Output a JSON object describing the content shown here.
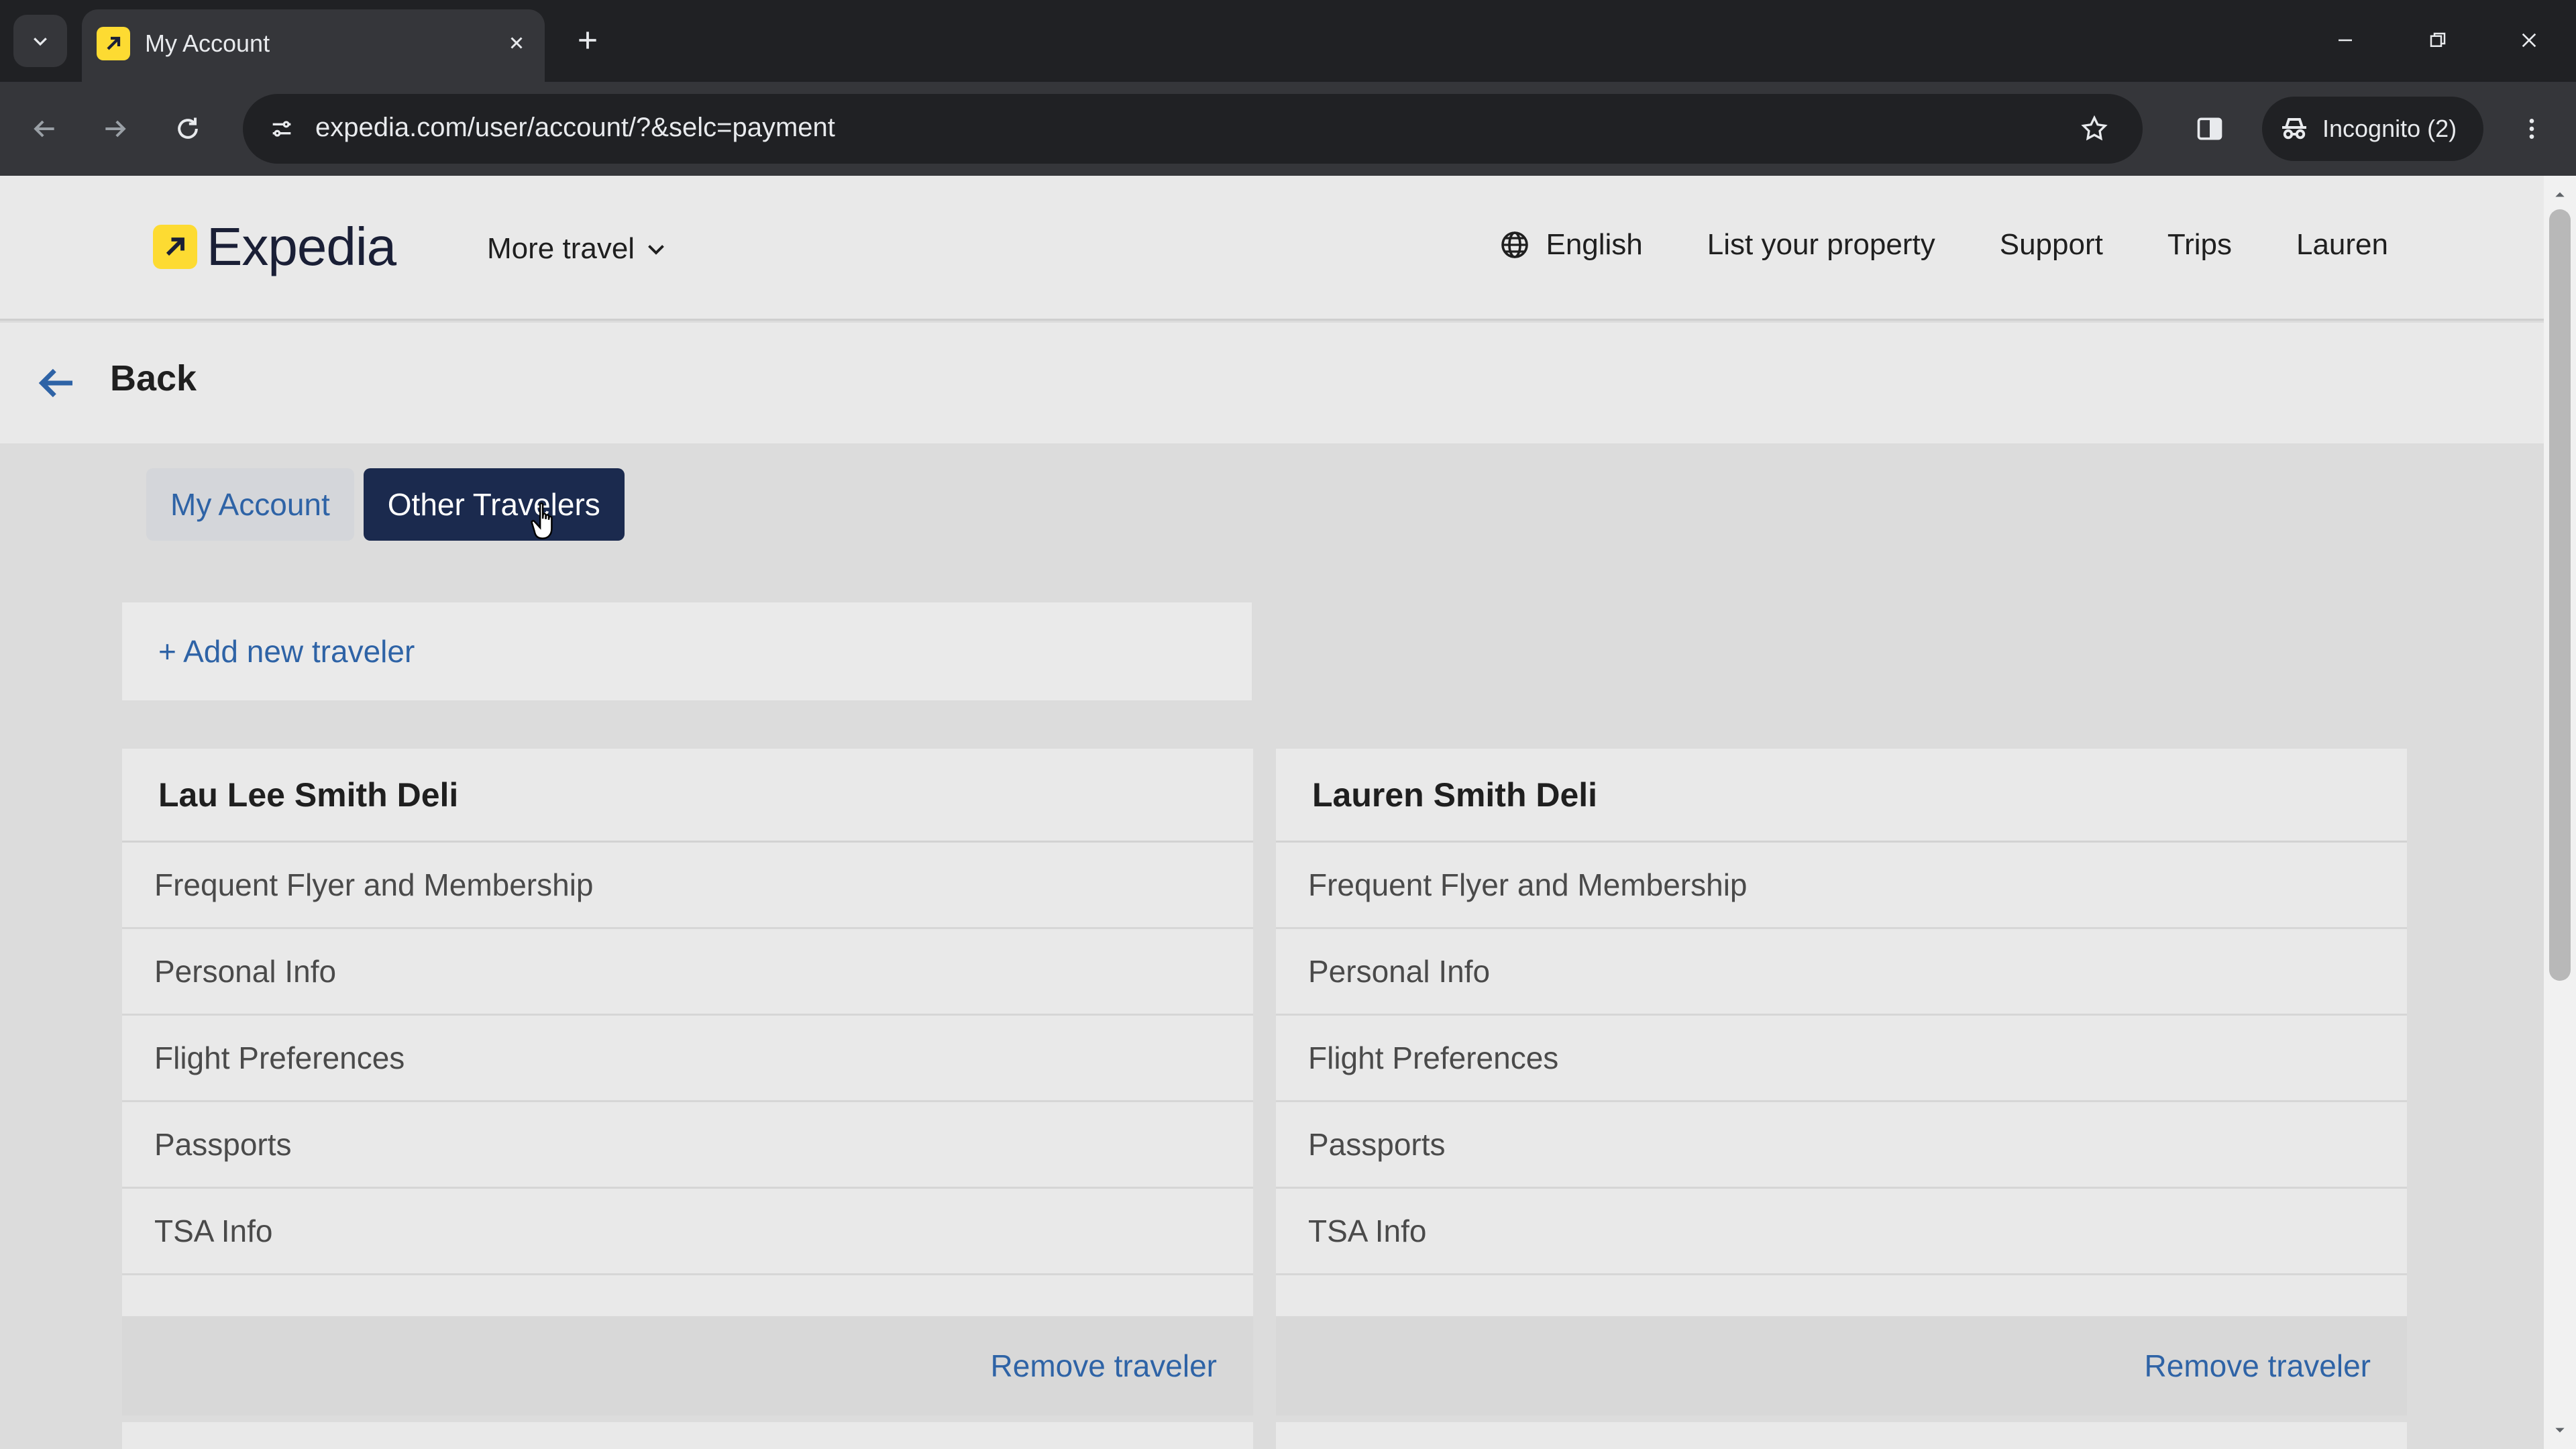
{
  "browser": {
    "tab_title": "My Account",
    "url": "expedia.com/user/account/?&selc=payment",
    "incognito_label": "Incognito (2)"
  },
  "header": {
    "logo_text": "Expedia",
    "more_travel": "More travel",
    "nav": {
      "language": "English",
      "list_property": "List your property",
      "support": "Support",
      "trips": "Trips",
      "user": "Lauren"
    }
  },
  "backbar": {
    "label": "Back"
  },
  "tabs": {
    "my_account": "My Account",
    "other_travelers": "Other Travelers",
    "active": "other_travelers"
  },
  "add_traveler": "+ Add new traveler",
  "travelers": [
    {
      "name": "Lau Lee Smith Deli",
      "rows": [
        "Frequent Flyer and Membership",
        "Personal Info",
        "Flight Preferences",
        "Passports",
        "TSA Info"
      ],
      "remove_label": "Remove traveler"
    },
    {
      "name": "Lauren Smith Deli",
      "rows": [
        "Frequent Flyer and Membership",
        "Personal Info",
        "Flight Preferences",
        "Passports",
        "TSA Info"
      ],
      "remove_label": "Remove traveler"
    }
  ],
  "colors": {
    "brand_yellow": "#fddb32",
    "link_blue": "#2e63a6",
    "active_tab": "#1b2a4e"
  }
}
